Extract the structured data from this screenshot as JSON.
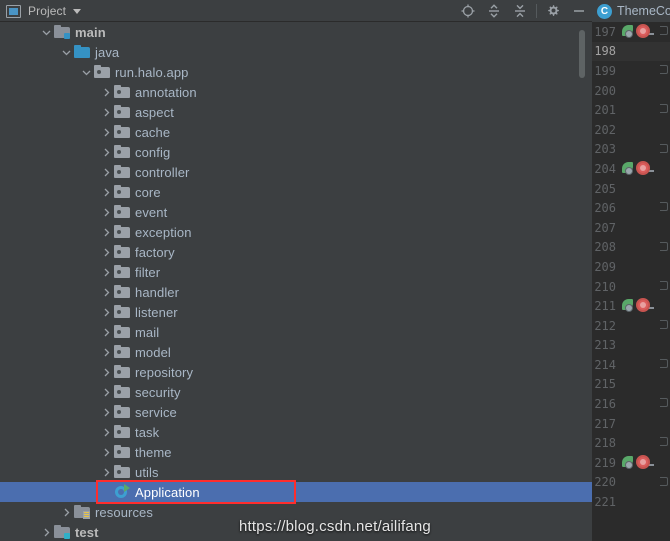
{
  "colors": {
    "panel_bg": "#3c3f41",
    "editor_bg": "#2b2b2b",
    "selection": "#4b6eaf",
    "annotation": "#ff2d2d",
    "text": "#a9b7c6",
    "line_number": "#606366",
    "source_root": "#3592c4",
    "run_green": "#59a869",
    "breakpoint_red": "#db5c5c"
  },
  "titlebar": {
    "panel_icon": "project-panel-icon",
    "label": "Project",
    "dropdown_icon": "chevron-down-icon",
    "actions": [
      {
        "name": "select-opened-file-button",
        "icon": "crosshair-target-icon"
      },
      {
        "name": "expand-all-button",
        "icon": "expand-all-icon"
      },
      {
        "name": "collapse-all-button",
        "icon": "collapse-all-icon"
      },
      {
        "name": "settings-button",
        "icon": "gear-icon"
      },
      {
        "name": "hide-button",
        "icon": "minimize-icon"
      }
    ]
  },
  "editor_tabs": [
    {
      "icon": "java-class-icon",
      "badge": "C",
      "label": "ThemeCo"
    }
  ],
  "tree": {
    "rows": [
      {
        "label": "main",
        "indent": 1,
        "twisty": "expanded",
        "icon": "module-folder-icon",
        "bold": true
      },
      {
        "label": "java",
        "indent": 2,
        "twisty": "expanded",
        "icon": "source-root-icon",
        "bold": false
      },
      {
        "label": "run.halo.app",
        "indent": 3,
        "twisty": "expanded",
        "icon": "package-folder-icon",
        "bold": false
      },
      {
        "label": "annotation",
        "indent": 4,
        "twisty": "collapsed",
        "icon": "package-folder-icon",
        "bold": false
      },
      {
        "label": "aspect",
        "indent": 4,
        "twisty": "collapsed",
        "icon": "package-folder-icon",
        "bold": false
      },
      {
        "label": "cache",
        "indent": 4,
        "twisty": "collapsed",
        "icon": "package-folder-icon",
        "bold": false
      },
      {
        "label": "config",
        "indent": 4,
        "twisty": "collapsed",
        "icon": "package-folder-icon",
        "bold": false
      },
      {
        "label": "controller",
        "indent": 4,
        "twisty": "collapsed",
        "icon": "package-folder-icon",
        "bold": false
      },
      {
        "label": "core",
        "indent": 4,
        "twisty": "collapsed",
        "icon": "package-folder-icon",
        "bold": false
      },
      {
        "label": "event",
        "indent": 4,
        "twisty": "collapsed",
        "icon": "package-folder-icon",
        "bold": false
      },
      {
        "label": "exception",
        "indent": 4,
        "twisty": "collapsed",
        "icon": "package-folder-icon",
        "bold": false
      },
      {
        "label": "factory",
        "indent": 4,
        "twisty": "collapsed",
        "icon": "package-folder-icon",
        "bold": false
      },
      {
        "label": "filter",
        "indent": 4,
        "twisty": "collapsed",
        "icon": "package-folder-icon",
        "bold": false
      },
      {
        "label": "handler",
        "indent": 4,
        "twisty": "collapsed",
        "icon": "package-folder-icon",
        "bold": false
      },
      {
        "label": "listener",
        "indent": 4,
        "twisty": "collapsed",
        "icon": "package-folder-icon",
        "bold": false
      },
      {
        "label": "mail",
        "indent": 4,
        "twisty": "collapsed",
        "icon": "package-folder-icon",
        "bold": false
      },
      {
        "label": "model",
        "indent": 4,
        "twisty": "collapsed",
        "icon": "package-folder-icon",
        "bold": false
      },
      {
        "label": "repository",
        "indent": 4,
        "twisty": "collapsed",
        "icon": "package-folder-icon",
        "bold": false
      },
      {
        "label": "security",
        "indent": 4,
        "twisty": "collapsed",
        "icon": "package-folder-icon",
        "bold": false
      },
      {
        "label": "service",
        "indent": 4,
        "twisty": "collapsed",
        "icon": "package-folder-icon",
        "bold": false
      },
      {
        "label": "task",
        "indent": 4,
        "twisty": "collapsed",
        "icon": "package-folder-icon",
        "bold": false
      },
      {
        "label": "theme",
        "indent": 4,
        "twisty": "collapsed",
        "icon": "package-folder-icon",
        "bold": false
      },
      {
        "label": "utils",
        "indent": 4,
        "twisty": "collapsed",
        "icon": "package-folder-icon",
        "bold": false
      },
      {
        "label": "Application",
        "indent": 4,
        "twisty": "none",
        "icon": "runnable-class-icon",
        "bold": false,
        "selected": true,
        "annotated": true
      },
      {
        "label": "resources",
        "indent": 2,
        "twisty": "collapsed",
        "icon": "resource-root-icon",
        "bold": false
      },
      {
        "label": "test",
        "indent": 1,
        "twisty": "collapsed",
        "icon": "test-module-folder-icon",
        "bold": true
      }
    ]
  },
  "editor_gutter": {
    "first_line": 197,
    "last_line": 221,
    "current_line": 198,
    "marked_lines": [
      197,
      204,
      211,
      219
    ],
    "marker_icons": [
      "run-gutter-icon",
      "breakpoint-icon"
    ],
    "fold_lines": [
      197,
      199,
      201,
      203,
      206,
      208,
      210,
      212,
      214,
      216,
      218,
      220
    ]
  },
  "watermark": {
    "text": "https://blog.csdn.net/ailifang"
  }
}
